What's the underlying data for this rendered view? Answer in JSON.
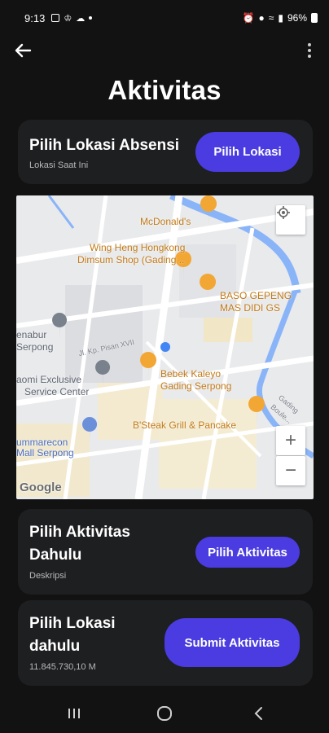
{
  "status_bar": {
    "time": "9:13",
    "battery": "96%"
  },
  "appbar": {
    "back_icon": "arrow-left-icon",
    "menu_icon": "more-vertical-icon"
  },
  "page": {
    "title": "Aktivitas"
  },
  "location_card": {
    "title": "Pilih Lokasi Absensi",
    "subtitle": "Lokasi Saat Ini",
    "button_label": "Pilih Lokasi"
  },
  "map": {
    "labels": [
      "McDonald's",
      "Wing Heng Hongkong",
      "Dimsum Shop (Gading ..",
      "BASO GEPENG",
      "MAS DIDI GS",
      "Bebek Kaleyo",
      "Gading Serpong",
      "B'Steak Grill & Pancake",
      "aomi Exclusive",
      "Service Center",
      "ummarecon",
      "Mall Serpong",
      "enabur",
      "Serpong",
      "Jl. Kp. Pisan XVII",
      "Gading Boule...",
      "Google"
    ],
    "zoom_in": "+",
    "zoom_out": "−"
  },
  "activity_card": {
    "title_line1": "Pilih Aktivitas",
    "title_line2": "Dahulu",
    "subtitle": "Deskripsi",
    "button_label": "Pilih Aktivitas"
  },
  "submit_card": {
    "title_line1": "Pilih Lokasi",
    "title_line2": "dahulu",
    "subtitle": "11.845.730,10 M",
    "button_label": "Submit Aktivitas"
  },
  "colors": {
    "background": "#121212",
    "card": "#1e1f21",
    "accent": "#4a3ce0",
    "map_bg": "#e9eaec"
  }
}
